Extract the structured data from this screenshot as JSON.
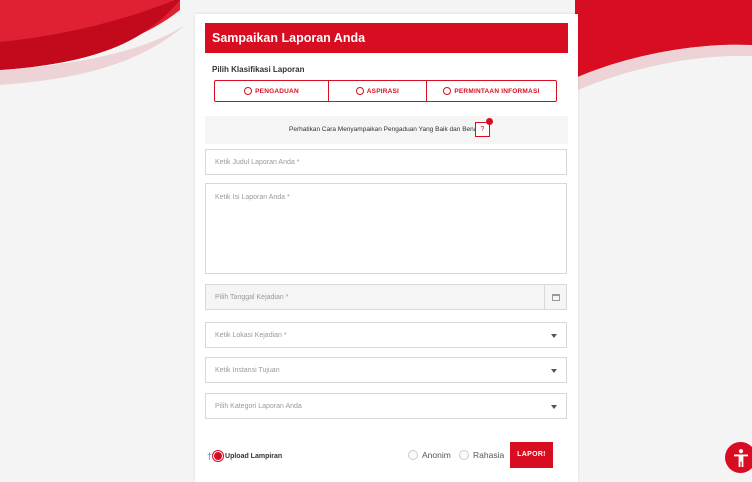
{
  "colors": {
    "accent": "#d80d21",
    "background": "#f4f4f4"
  },
  "form": {
    "title": "Sampaikan Laporan Anda",
    "classification_label": "Pilih Klasifikasi Laporan",
    "classification_options": [
      "PENGADUAN",
      "ASPIRASI",
      "PERMINTAAN INFORMASI"
    ],
    "notice_text": "Perhatikan Cara Menyampaikan Pengaduan Yang Baik dan Benar",
    "help_label": "?",
    "fields": {
      "title_placeholder": "Ketik Judul Laporan Anda *",
      "content_placeholder": "Ketik Isi Laporan Anda *",
      "date_placeholder": "Pilih Tanggal Kejadian *",
      "location_placeholder": "Ketik Lokasi Kejadian *",
      "agency_placeholder": "Ketik Instansi Tujuan",
      "category_placeholder": "Pilih Kategori Laporan Anda"
    },
    "upload_label": "Upload Lampiran",
    "anonymous_label": "Anonim",
    "secret_label": "Rahasia",
    "submit_label": "LAPOR!"
  },
  "icons": {
    "help": "question-icon",
    "calendar": "calendar-icon",
    "dropdown": "chevron-down-icon",
    "upload": "paperclip-icon",
    "accessibility": "accessibility-icon"
  }
}
